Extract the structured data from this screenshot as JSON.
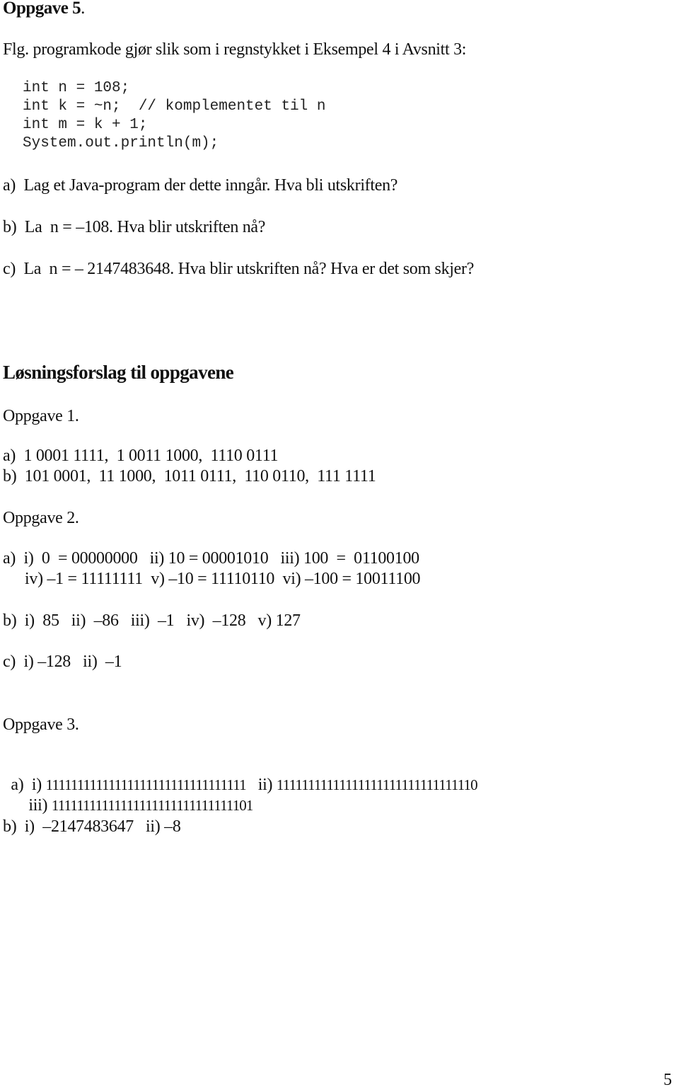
{
  "exercise5": {
    "title": "Oppgave 5",
    "title_period": ".",
    "intro": "Flg. programkode gjør slik som i regnstykket i Eksempel 4 i Avsnitt 3:",
    "code_lines": [
      "int n = 108;",
      "int k = ~n;  // komplementet til n",
      "int m = k + 1;",
      "System.out.println(m);"
    ],
    "questions": [
      "a)  Lag et Java-program der dette inngår. Hva bli utskriften?",
      "b)  La  n = –108. Hva blir utskriften nå?",
      "c)  La  n = – 2147483648. Hva blir utskriften nå? Hva er det som skjer?"
    ]
  },
  "solutions": {
    "heading": "Løsningsforslag til oppgavene",
    "exercise1": {
      "title": "Oppgave 1.",
      "lines": [
        "a)  1 0001 1111,  1 0011 1000,  1110 0111",
        "b)  101 0001,  11 1000,  1011 0111,  110 0110,  111 1111"
      ]
    },
    "exercise2": {
      "title": "Oppgave 2.",
      "a_line1": "a)  i)  0  = 00000000   ii) 10 = 00001010   iii) 100  =  01100100",
      "a_line2": "iv) –1 = 11111111  v) –10 = 11110110  vi) –100 = 10011100",
      "b_line": "b)  i)  85   ii)  –86   iii)  –1   iv)  –128   v) 127",
      "c_line": "c)  i) –128   ii)  –1"
    },
    "exercise3": {
      "title": "Oppgave 3.",
      "a_prefix": "a)  i) ",
      "a_i": "11111111111111111111111111111111",
      "a_ii_label": "ii) ",
      "a_ii": "11111111111111111111111111111110",
      "a_iii_label": "iii) ",
      "a_iii": "11111111111111111111111111111101",
      "b_line": "b)  i)  –2147483647   ii) –8"
    }
  },
  "page_number": "5"
}
